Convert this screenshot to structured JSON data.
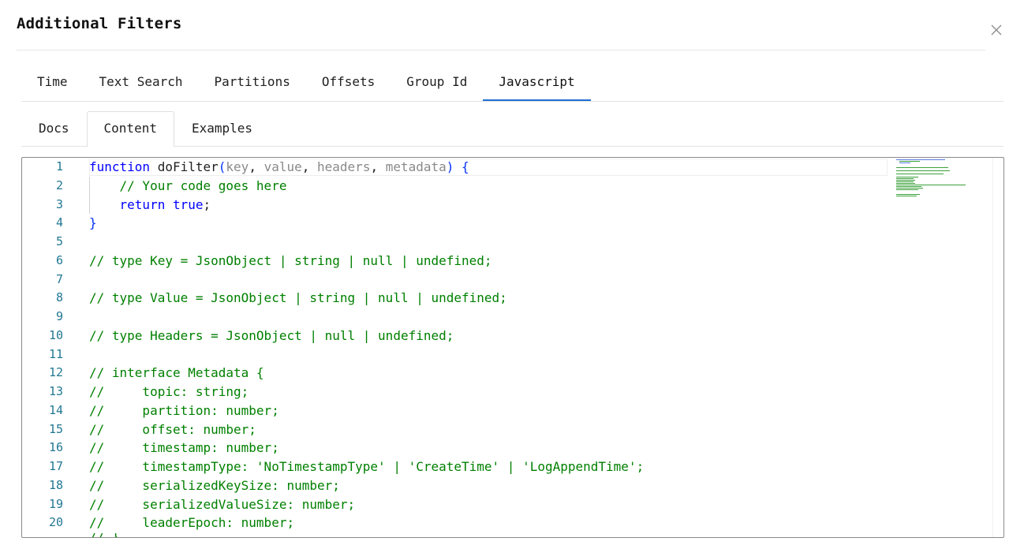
{
  "dialog": {
    "title": "Additional Filters",
    "close_icon": "close-icon"
  },
  "main_tabs": [
    {
      "label": "Time",
      "active": false
    },
    {
      "label": "Text Search",
      "active": false
    },
    {
      "label": "Partitions",
      "active": false
    },
    {
      "label": "Offsets",
      "active": false
    },
    {
      "label": "Group Id",
      "active": false
    },
    {
      "label": "Javascript",
      "active": true
    }
  ],
  "sub_tabs": [
    {
      "label": "Docs",
      "active": false
    },
    {
      "label": "Content",
      "active": true
    },
    {
      "label": "Examples",
      "active": false
    }
  ],
  "editor": {
    "line_numbers": [
      "1",
      "2",
      "3",
      "4",
      "5",
      "6",
      "7",
      "8",
      "9",
      "10",
      "11",
      "12",
      "13",
      "14",
      "15",
      "16",
      "17",
      "18",
      "19",
      "20"
    ],
    "line1": {
      "kw": "function",
      "name": " doFilter",
      "open": "(",
      "p1": "key",
      "sep1": ", ",
      "p2": "value",
      "sep2": ", ",
      "p3": "headers",
      "sep3": ", ",
      "p4": "metadata",
      "close": ") {"
    },
    "line2": "    // Your code goes here",
    "line3_kw": "    return",
    "line3_val": " true",
    "line3_end": ";",
    "line4": "}",
    "line6": "// type Key = JsonObject | string | null | undefined;",
    "line8": "// type Value = JsonObject | string | null | undefined;",
    "line10": "// type Headers = JsonObject | null | undefined;",
    "line12": "// interface Metadata {",
    "line13": "//     topic: string;",
    "line14": "//     partition: number;",
    "line15": "//     offset: number;",
    "line16": "//     timestamp: number;",
    "line17": "//     timestampType: 'NoTimestampType' | 'CreateTime' | 'LogAppendTime';",
    "line18": "//     serializedKeySize: number;",
    "line19": "//     serializedValueSize: number;",
    "line20": "//     leaderEpoch: number;",
    "line21_partial": "// }"
  },
  "colors": {
    "keyword": "#0000ff",
    "comment": "#008000",
    "line_number": "#237893",
    "param": "#8a8a8a",
    "active_tab_underline": "#1f6fd6"
  }
}
